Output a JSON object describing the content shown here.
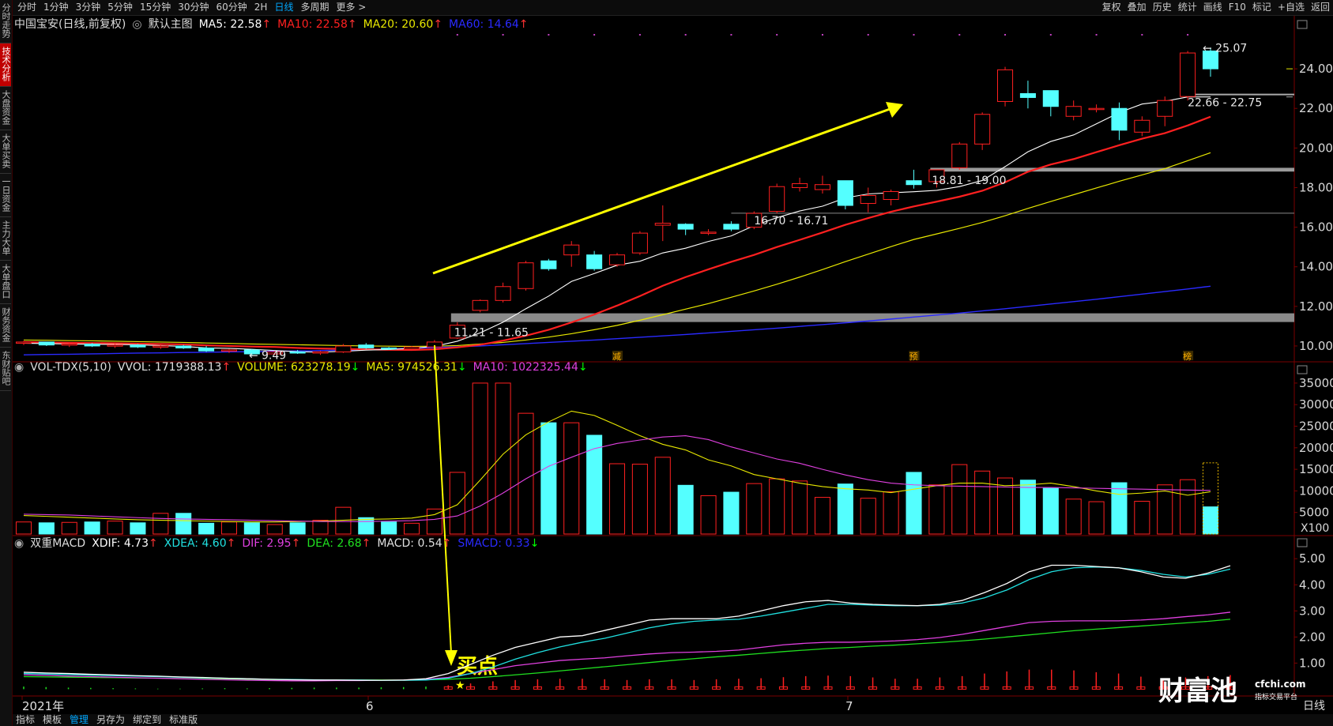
{
  "sidebar": {
    "items": [
      {
        "label": "分时走势",
        "active": false
      },
      {
        "label": "技术分析",
        "active": true
      },
      {
        "label": "大盘资金",
        "active": false
      },
      {
        "label": "大单买卖",
        "active": false
      },
      {
        "label": "一日资金",
        "active": false
      },
      {
        "label": "主力大单",
        "active": false
      },
      {
        "label": "大单盘口",
        "active": false
      },
      {
        "label": "财务资金",
        "active": false
      },
      {
        "label": "东财贴吧",
        "active": false
      }
    ]
  },
  "topbar": {
    "periods": [
      "分时",
      "1分钟",
      "3分钟",
      "5分钟",
      "15分钟",
      "30分钟",
      "60分钟",
      "2H",
      "日线",
      "多周期",
      "更多 >"
    ],
    "active_period": "日线",
    "tools": [
      "复权",
      "叠加",
      "历史",
      "统计",
      "画线",
      "F10",
      "标记",
      "+自选",
      "返回"
    ]
  },
  "main_legend": {
    "title": "中国宝安(日线,前复权)",
    "template": "默认主图",
    "items": [
      {
        "label": "MA5: 22.58",
        "color": "#ffffff",
        "arrow": "↑"
      },
      {
        "label": "MA10: 22.58",
        "color": "#ff2020",
        "arrow": "↑"
      },
      {
        "label": "MA20: 20.60",
        "color": "#e8e800",
        "arrow": "↑"
      },
      {
        "label": "MA60: 14.64",
        "color": "#2a2aff",
        "arrow": "↑"
      }
    ]
  },
  "vol_legend": {
    "title": "VOL-TDX(5,10)",
    "items": [
      {
        "label": "VVOL: 1719388.13",
        "color": "#e0e0e0",
        "arrow": "↑"
      },
      {
        "label": "VOLUME: 623278.19",
        "color": "#e8e800",
        "arrow": "↓"
      },
      {
        "label": "MA5: 974526.31",
        "color": "#e8e800",
        "arrow": "↓"
      },
      {
        "label": "MA10: 1022325.44",
        "color": "#e040e0",
        "arrow": "↓"
      }
    ]
  },
  "macd_legend": {
    "title": "双重MACD",
    "items": [
      {
        "label": "XDIF: 4.73",
        "color": "#ffffff",
        "arrow": "↑"
      },
      {
        "label": "XDEA: 4.60",
        "color": "#20e0e0",
        "arrow": "↑"
      },
      {
        "label": "DIF: 2.95",
        "color": "#e040e0",
        "arrow": "↑"
      },
      {
        "label": "DEA: 2.68",
        "color": "#20e020",
        "arrow": "↑"
      },
      {
        "label": "MACD: 0.54",
        "color": "#e0e0e0",
        "arrow": "↑"
      },
      {
        "label": "SMACD: 0.33",
        "color": "#2a2aff",
        "arrow": "↓"
      }
    ]
  },
  "bottombar": {
    "items": [
      "指标",
      "模板",
      "管理",
      "另存为",
      "绑定到",
      "标准版"
    ],
    "active": "管理"
  },
  "annotations": {
    "range_1": "11.21 - 11.65",
    "range_2": "16.70 - 16.71",
    "range_3": "18.81 - 19.00",
    "range_4": "22.66 - 22.75",
    "low_label": "9.49",
    "high_label": "25.07",
    "buy_point": "买点",
    "markers": [
      "减",
      "预",
      "榜"
    ]
  },
  "x_labels": [
    "2021年",
    "6",
    "7"
  ],
  "corner": {
    "period": "日线",
    "pm": "+  -"
  },
  "watermark": {
    "brand": "财富池",
    "site": "cfchi.com",
    "tag": "指标交易平台"
  },
  "colors": {
    "up": "#ff2020",
    "down": "#54ffff",
    "ma5": "#ffffff",
    "ma10": "#ff2020",
    "ma20": "#e8e800",
    "ma60": "#2a2aff",
    "arrow": "#ffff00"
  },
  "chart_data": [
    {
      "type": "candlestick",
      "title": "中国宝安(日线,前复权)",
      "ylim": [
        9.2,
        25.8
      ],
      "yticks": [
        10,
        12,
        14,
        16,
        18,
        20,
        22,
        24
      ],
      "candles": [
        [
          10.15,
          10.25,
          10.05,
          10.2
        ],
        [
          10.2,
          10.2,
          10.0,
          10.05
        ],
        [
          10.05,
          10.15,
          9.95,
          10.1
        ],
        [
          10.1,
          10.15,
          9.95,
          10.0
        ],
        [
          10.0,
          10.1,
          9.9,
          10.05
        ],
        [
          10.05,
          10.1,
          9.9,
          9.95
        ],
        [
          9.95,
          10.05,
          9.85,
          10.0
        ],
        [
          10.0,
          10.05,
          9.85,
          9.9
        ],
        [
          9.9,
          10.0,
          9.7,
          9.75
        ],
        [
          9.75,
          9.85,
          9.65,
          9.8
        ],
        [
          9.8,
          9.85,
          9.49,
          9.6
        ],
        [
          9.6,
          9.75,
          9.55,
          9.7
        ],
        [
          9.7,
          9.8,
          9.6,
          9.65
        ],
        [
          9.65,
          9.75,
          9.55,
          9.7
        ],
        [
          9.7,
          10.1,
          9.65,
          10.0
        ],
        [
          10.05,
          10.15,
          9.85,
          9.9
        ],
        [
          9.9,
          9.95,
          9.8,
          9.85
        ],
        [
          9.85,
          10.0,
          9.8,
          9.95
        ],
        [
          9.95,
          10.3,
          9.9,
          10.2
        ],
        [
          10.4,
          11.2,
          10.35,
          11.05
        ],
        [
          11.8,
          12.35,
          11.7,
          12.3
        ],
        [
          12.3,
          13.2,
          12.2,
          13.0
        ],
        [
          12.9,
          14.3,
          12.8,
          14.2
        ],
        [
          14.3,
          14.4,
          13.8,
          13.9
        ],
        [
          14.6,
          15.3,
          14.0,
          15.1
        ],
        [
          14.6,
          14.8,
          13.8,
          13.9
        ],
        [
          14.1,
          14.7,
          14.0,
          14.6
        ],
        [
          14.7,
          15.8,
          14.6,
          15.7
        ],
        [
          16.1,
          17.1,
          15.3,
          16.2
        ],
        [
          16.15,
          16.2,
          15.6,
          15.9
        ],
        [
          15.7,
          15.9,
          15.6,
          15.75
        ],
        [
          16.15,
          16.3,
          15.8,
          15.9
        ],
        [
          16.0,
          16.8,
          15.9,
          16.7
        ],
        [
          16.8,
          18.2,
          16.7,
          18.05
        ],
        [
          18.0,
          18.5,
          17.8,
          18.2
        ],
        [
          17.9,
          18.6,
          17.7,
          18.15
        ],
        [
          18.35,
          18.35,
          16.9,
          17.1
        ],
        [
          17.2,
          18.0,
          16.75,
          17.6
        ],
        [
          17.4,
          17.9,
          17.1,
          17.8
        ],
        [
          18.35,
          18.9,
          17.95,
          18.15
        ],
        [
          18.3,
          18.9,
          18.0,
          18.9
        ],
        [
          19.0,
          20.3,
          18.9,
          20.2
        ],
        [
          20.2,
          21.8,
          19.9,
          21.7
        ],
        [
          22.35,
          24.1,
          22.1,
          23.95
        ],
        [
          22.75,
          23.4,
          22.0,
          22.55
        ],
        [
          22.9,
          22.9,
          21.6,
          22.1
        ],
        [
          21.6,
          22.4,
          21.4,
          22.1
        ],
        [
          22.0,
          22.2,
          21.8,
          22.0
        ],
        [
          22.0,
          22.3,
          20.4,
          20.9
        ],
        [
          20.8,
          21.6,
          20.6,
          21.4
        ],
        [
          21.6,
          22.6,
          21.1,
          22.4
        ],
        [
          22.6,
          24.9,
          22.4,
          24.8
        ],
        [
          24.9,
          25.07,
          23.6,
          24.0
        ]
      ],
      "ma5": [
        10.14,
        10.12,
        10.1,
        10.09,
        10.08,
        10.06,
        10.02,
        9.98,
        9.9,
        9.88,
        9.83,
        9.77,
        9.71,
        9.69,
        9.73,
        9.79,
        9.82,
        9.88,
        9.98,
        10.24,
        10.66,
        11.2,
        11.88,
        12.52,
        13.26,
        13.66,
        14.08,
        14.28,
        14.7,
        14.94,
        15.28,
        15.56,
        16.08,
        16.48,
        16.82,
        17.06,
        17.48,
        17.68,
        17.74,
        17.79,
        17.86,
        18.05,
        18.36,
        19.06,
        19.81,
        20.33,
        20.66,
        21.22,
        21.79,
        22.22,
        22.36,
        22.58,
        22.58
      ],
      "ma10": [
        10.2,
        10.18,
        10.16,
        10.15,
        10.14,
        10.12,
        10.1,
        10.08,
        10.03,
        10.0,
        9.97,
        9.95,
        9.9,
        9.87,
        9.85,
        9.83,
        9.81,
        9.8,
        9.83,
        9.93,
        10.06,
        10.27,
        10.52,
        10.82,
        11.19,
        11.59,
        12.04,
        12.52,
        13.04,
        13.48,
        13.87,
        14.25,
        14.6,
        15.0,
        15.36,
        15.73,
        16.12,
        16.46,
        16.78,
        17.05,
        17.29,
        17.54,
        17.84,
        18.27,
        18.8,
        19.17,
        19.44,
        19.79,
        20.14,
        20.47,
        20.75,
        21.14,
        21.58
      ],
      "ma20": [
        10.3,
        10.29,
        10.27,
        10.26,
        10.24,
        10.22,
        10.2,
        10.18,
        10.15,
        10.13,
        10.1,
        10.08,
        10.06,
        10.04,
        10.02,
        10.0,
        9.99,
        9.98,
        9.99,
        10.02,
        10.1,
        10.18,
        10.3,
        10.45,
        10.62,
        10.82,
        11.04,
        11.3,
        11.58,
        11.86,
        12.14,
        12.46,
        12.78,
        13.12,
        13.48,
        13.86,
        14.26,
        14.64,
        15.02,
        15.38,
        15.66,
        15.94,
        16.24,
        16.58,
        16.95,
        17.3,
        17.64,
        17.98,
        18.32,
        18.64,
        18.96,
        19.36,
        19.76
      ],
      "ma60": [
        9.55,
        9.57,
        9.58,
        9.6,
        9.62,
        9.64,
        9.65,
        9.67,
        9.68,
        9.7,
        9.71,
        9.73,
        9.75,
        9.77,
        9.79,
        9.82,
        9.85,
        9.88,
        9.92,
        9.96,
        10.0,
        10.06,
        10.12,
        10.18,
        10.24,
        10.3,
        10.37,
        10.44,
        10.51,
        10.58,
        10.66,
        10.74,
        10.82,
        10.9,
        10.99,
        11.08,
        11.17,
        11.26,
        11.36,
        11.46,
        11.56,
        11.66,
        11.77,
        11.88,
        12.0,
        12.12,
        12.24,
        12.36,
        12.49,
        12.62,
        12.75,
        12.88,
        13.02
      ]
    },
    {
      "type": "bar",
      "title": "VOL-TDX(5,10)",
      "ylim": [
        0,
        37000
      ],
      "yticks": [
        5000,
        10000,
        15000,
        20000,
        25000,
        30000,
        35000
      ],
      "y_unit": "X100",
      "volume": [
        2800,
        2600,
        2700,
        2800,
        3000,
        2600,
        4800,
        4800,
        2500,
        2800,
        2600,
        2200,
        2600,
        3200,
        6200,
        3800,
        2800,
        2500,
        5800,
        14300,
        35000,
        35000,
        28000,
        25800,
        25800,
        22900,
        16300,
        16200,
        17800,
        11300,
        8900,
        9700,
        11700,
        12800,
        12300,
        8500,
        11600,
        8300,
        9800,
        14300,
        11400,
        16100,
        14600,
        13000,
        12500,
        10600,
        8100,
        7500,
        11900,
        7600,
        11400,
        12600,
        6300
      ],
      "ma5": [
        4300,
        4100,
        3900,
        3700,
        3500,
        3300,
        3200,
        3100,
        3000,
        2900,
        2800,
        2800,
        2900,
        3000,
        3200,
        3400,
        3500,
        3700,
        4500,
        6800,
        12500,
        18500,
        23000,
        26000,
        28500,
        27500,
        25200,
        22800,
        20800,
        19500,
        17200,
        15800,
        13800,
        12800,
        11800,
        11000,
        10500,
        10200,
        9600,
        10400,
        11200,
        11800,
        11800,
        11200,
        11400,
        11800,
        11000,
        10000,
        9200,
        9500,
        10000,
        9000,
        9800
      ],
      "ma10": [
        4600,
        4500,
        4400,
        4200,
        4000,
        3800,
        3600,
        3500,
        3400,
        3300,
        3200,
        3100,
        3000,
        2900,
        2900,
        2900,
        3000,
        3100,
        3400,
        4200,
        6500,
        9500,
        12800,
        15700,
        17800,
        19800,
        21000,
        21800,
        22500,
        22800,
        21900,
        20200,
        18800,
        17400,
        16400,
        15000,
        13700,
        12600,
        11800,
        11400,
        11200,
        11100,
        11000,
        10900,
        10800,
        10800,
        10700,
        10600,
        10500,
        10400,
        10300,
        10200,
        10100
      ]
    },
    {
      "type": "line",
      "title": "双重MACD",
      "ylim": [
        -0.2,
        5.4
      ],
      "yticks": [
        1.0,
        2.0,
        3.0,
        4.0,
        5.0
      ],
      "xdif": [
        0.65,
        0.62,
        0.6,
        0.57,
        0.55,
        0.52,
        0.5,
        0.47,
        0.45,
        0.42,
        0.4,
        0.38,
        0.36,
        0.35,
        0.35,
        0.34,
        0.34,
        0.35,
        0.4,
        0.6,
        0.95,
        1.3,
        1.6,
        1.8,
        2.0,
        2.05,
        2.25,
        2.45,
        2.65,
        2.7,
        2.7,
        2.7,
        2.8,
        3.0,
        3.2,
        3.35,
        3.4,
        3.3,
        3.25,
        3.22,
        3.2,
        3.25,
        3.4,
        3.7,
        4.05,
        4.5,
        4.75,
        4.75,
        4.7,
        4.65,
        4.5,
        4.3,
        4.25,
        4.45,
        4.73
      ],
      "xdea": [
        0.6,
        0.58,
        0.56,
        0.54,
        0.52,
        0.5,
        0.48,
        0.46,
        0.44,
        0.42,
        0.4,
        0.38,
        0.37,
        0.36,
        0.35,
        0.35,
        0.34,
        0.34,
        0.35,
        0.42,
        0.6,
        0.85,
        1.15,
        1.4,
        1.62,
        1.8,
        1.95,
        2.15,
        2.35,
        2.5,
        2.6,
        2.65,
        2.68,
        2.8,
        2.95,
        3.1,
        3.25,
        3.25,
        3.22,
        3.2,
        3.2,
        3.22,
        3.3,
        3.5,
        3.8,
        4.2,
        4.5,
        4.65,
        4.68,
        4.65,
        4.55,
        4.4,
        4.3,
        4.4,
        4.6
      ],
      "dif": [
        0.55,
        0.53,
        0.5,
        0.48,
        0.46,
        0.44,
        0.42,
        0.4,
        0.38,
        0.36,
        0.34,
        0.33,
        0.32,
        0.32,
        0.33,
        0.33,
        0.34,
        0.35,
        0.38,
        0.45,
        0.6,
        0.75,
        0.9,
        1.0,
        1.1,
        1.15,
        1.2,
        1.28,
        1.35,
        1.4,
        1.42,
        1.45,
        1.5,
        1.6,
        1.7,
        1.76,
        1.8,
        1.8,
        1.82,
        1.85,
        1.9,
        1.98,
        2.1,
        2.25,
        2.4,
        2.55,
        2.6,
        2.62,
        2.62,
        2.62,
        2.65,
        2.7,
        2.78,
        2.85,
        2.95
      ],
      "dea": [
        0.48,
        0.47,
        0.46,
        0.45,
        0.44,
        0.43,
        0.42,
        0.41,
        0.4,
        0.39,
        0.38,
        0.37,
        0.36,
        0.35,
        0.35,
        0.35,
        0.35,
        0.35,
        0.36,
        0.38,
        0.42,
        0.48,
        0.55,
        0.62,
        0.7,
        0.78,
        0.86,
        0.94,
        1.02,
        1.1,
        1.17,
        1.24,
        1.3,
        1.37,
        1.44,
        1.5,
        1.56,
        1.6,
        1.65,
        1.69,
        1.74,
        1.79,
        1.85,
        1.92,
        2.0,
        2.08,
        2.16,
        2.24,
        2.3,
        2.36,
        2.42,
        2.48,
        2.54,
        2.6,
        2.68
      ],
      "macd": [
        0.1,
        0.08,
        0.06,
        0.05,
        0.04,
        0.03,
        0.02,
        0.02,
        0.03,
        0.04,
        0.03,
        0.04,
        0.05,
        0.06,
        0.06,
        0.06,
        0.07,
        0.08,
        0.1,
        0.15,
        0.22,
        0.3,
        0.35,
        0.38,
        0.4,
        0.4,
        0.38,
        0.35,
        0.38,
        0.38,
        0.35,
        0.38,
        0.4,
        0.42,
        0.46,
        0.5,
        0.52,
        0.5,
        0.45,
        0.4,
        0.4,
        0.45,
        0.5,
        0.6,
        0.68,
        0.75,
        0.75,
        0.72,
        0.65,
        0.6,
        0.48,
        0.42,
        0.45,
        0.5,
        0.54
      ]
    }
  ]
}
